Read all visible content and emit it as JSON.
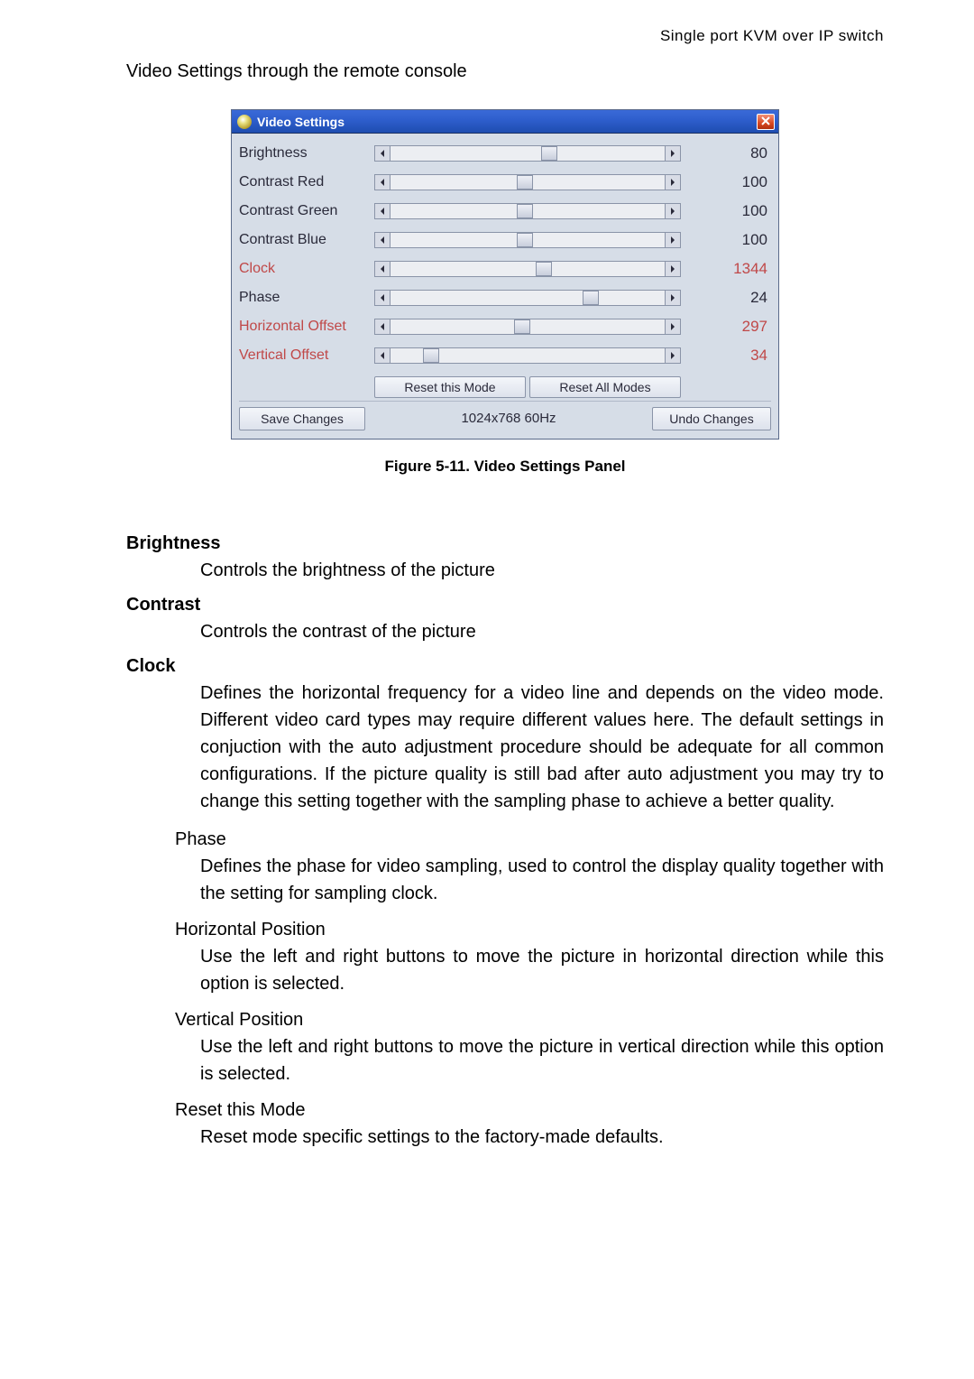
{
  "header_right": "Single port KVM over IP switch",
  "intro": "Video Settings through the remote console",
  "panel": {
    "title": "Video Settings",
    "sliders": [
      {
        "label": "Brightness",
        "value": "80",
        "thumb_pct": 55,
        "red": false
      },
      {
        "label": "Contrast Red",
        "value": "100",
        "thumb_pct": 46,
        "red": false
      },
      {
        "label": "Contrast Green",
        "value": "100",
        "thumb_pct": 46,
        "red": false
      },
      {
        "label": "Contrast Blue",
        "value": "100",
        "thumb_pct": 46,
        "red": false
      },
      {
        "label": "Clock",
        "value": "1344",
        "thumb_pct": 53,
        "red": true
      },
      {
        "label": "Phase",
        "value": "24",
        "thumb_pct": 70,
        "red": false
      },
      {
        "label": "Horizontal Offset",
        "value": "297",
        "thumb_pct": 45,
        "red": true
      },
      {
        "label": "Vertical Offset",
        "value": "34",
        "thumb_pct": 12,
        "red": true
      }
    ],
    "reset_this": "Reset this Mode",
    "reset_all": "Reset All Modes",
    "save": "Save Changes",
    "resolution": "1024x768 60Hz",
    "undo": "Undo Changes"
  },
  "caption": "Figure 5-11. Video Settings Panel",
  "doc": {
    "brightness_term": "Brightness",
    "brightness_def": "Controls the brightness of the picture",
    "contrast_term": "Contrast",
    "contrast_def": "Controls the contrast of the picture",
    "clock_term": "Clock",
    "clock_def": "Defines the horizontal frequency for a video line and depends on the video mode. Different video card types may require different values here. The default settings in conjuction with the auto adjustment procedure should be adequate for all common configurations. If the picture quality is still bad after auto adjustment you may try to change this setting together with the sampling phase to achieve a better quality.",
    "phase_term": "Phase",
    "phase_def": "Defines the phase for video sampling, used to control the display quality together with the setting for sampling clock.",
    "hpos_term": "Horizontal Position",
    "hpos_def": "Use the left and right buttons to move the picture in horizontal direction while this option is selected.",
    "vpos_term": "Vertical Position",
    "vpos_def": "Use the left and right buttons to move the picture in vertical direction while this option is selected.",
    "resetmode_term": "Reset this Mode",
    "resetmode_def": "Reset mode specific settings to the factory-made defaults."
  }
}
